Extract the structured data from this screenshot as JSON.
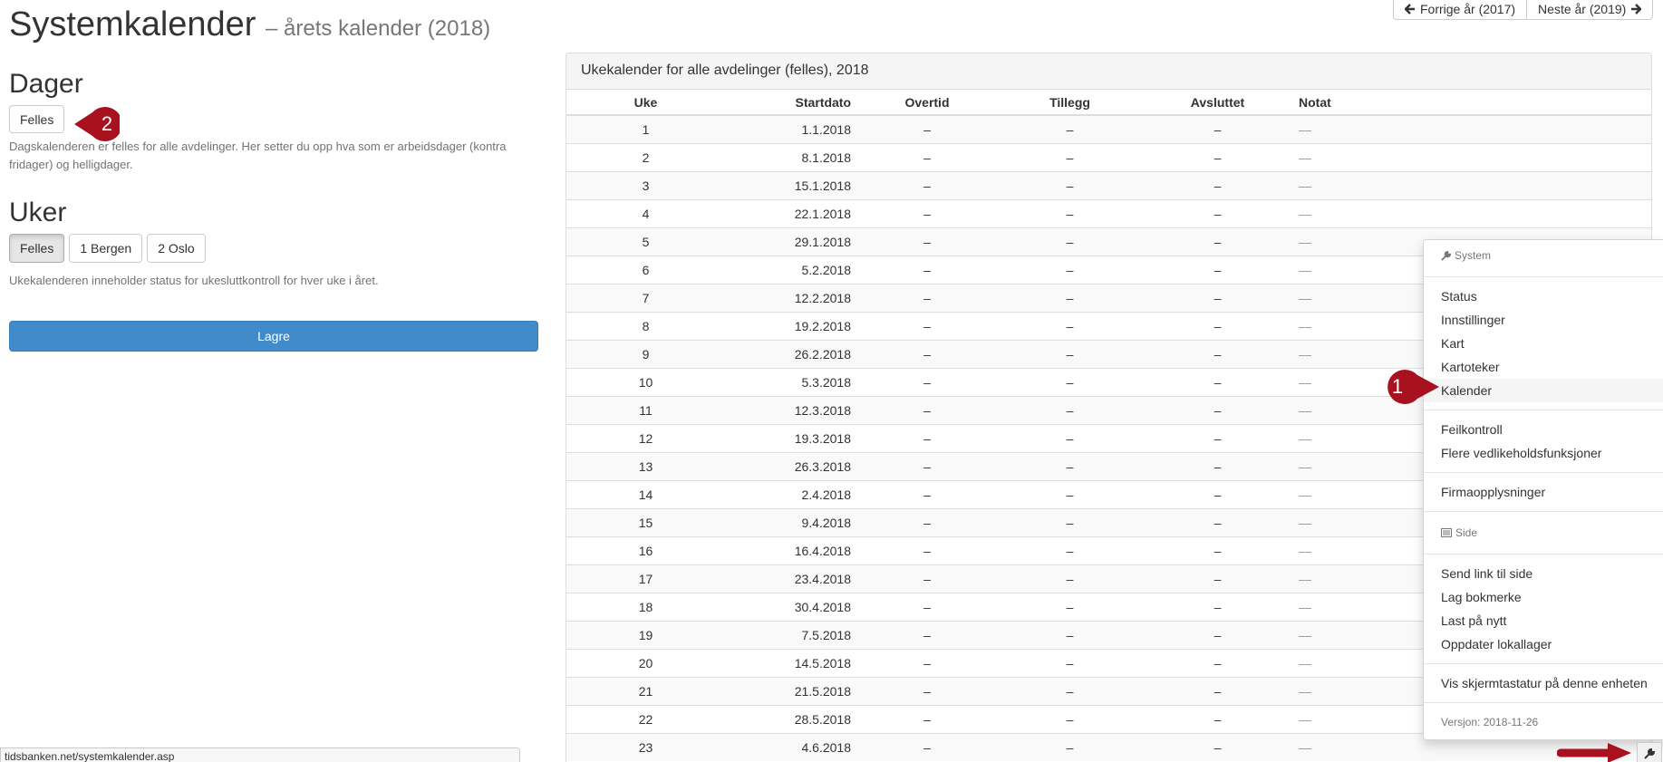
{
  "header": {
    "title": "Systemkalender",
    "subtitle": "– årets kalender (2018)",
    "prev_year": "Forrige år (2017)",
    "next_year": "Neste år (2019)"
  },
  "days": {
    "heading": "Dager",
    "felles_button": "Felles",
    "help": "Dagskalenderen er felles for alle avdelinger. Her setter du opp hva som er arbeidsdager (kontra fridager) og helligdager."
  },
  "weeks": {
    "heading": "Uker",
    "buttons": [
      "Felles",
      "1 Bergen",
      "2 Oslo"
    ],
    "help": "Ukekalenderen inneholder status for ukesluttkontroll for hver uke i året."
  },
  "save_label": "Lagre",
  "markers": {
    "one": "1",
    "two": "2"
  },
  "panel": {
    "heading": "Ukekalender for alle avdelinger (felles), 2018",
    "columns": [
      "Uke",
      "Startdato",
      "Overtid",
      "Tillegg",
      "Avsluttet",
      "Notat"
    ],
    "rows": [
      [
        "1",
        "1.1.2018",
        "–",
        "–",
        "–",
        "—"
      ],
      [
        "2",
        "8.1.2018",
        "–",
        "–",
        "–",
        "—"
      ],
      [
        "3",
        "15.1.2018",
        "–",
        "–",
        "–",
        "—"
      ],
      [
        "4",
        "22.1.2018",
        "–",
        "–",
        "–",
        "—"
      ],
      [
        "5",
        "29.1.2018",
        "–",
        "–",
        "–",
        "—"
      ],
      [
        "6",
        "5.2.2018",
        "–",
        "–",
        "–",
        "—"
      ],
      [
        "7",
        "12.2.2018",
        "–",
        "–",
        "–",
        "—"
      ],
      [
        "8",
        "19.2.2018",
        "–",
        "–",
        "–",
        "—"
      ],
      [
        "9",
        "26.2.2018",
        "–",
        "–",
        "–",
        "—"
      ],
      [
        "10",
        "5.3.2018",
        "–",
        "–",
        "–",
        "—"
      ],
      [
        "11",
        "12.3.2018",
        "–",
        "–",
        "–",
        "—"
      ],
      [
        "12",
        "19.3.2018",
        "–",
        "–",
        "–",
        "—"
      ],
      [
        "13",
        "26.3.2018",
        "–",
        "–",
        "–",
        "—"
      ],
      [
        "14",
        "2.4.2018",
        "–",
        "–",
        "–",
        "—"
      ],
      [
        "15",
        "9.4.2018",
        "–",
        "–",
        "–",
        "—"
      ],
      [
        "16",
        "16.4.2018",
        "–",
        "–",
        "–",
        "—"
      ],
      [
        "17",
        "23.4.2018",
        "–",
        "–",
        "–",
        "—"
      ],
      [
        "18",
        "30.4.2018",
        "–",
        "–",
        "–",
        "—"
      ],
      [
        "19",
        "7.5.2018",
        "–",
        "–",
        "–",
        "—"
      ],
      [
        "20",
        "14.5.2018",
        "–",
        "–",
        "–",
        "—"
      ],
      [
        "21",
        "21.5.2018",
        "–",
        "–",
        "–",
        "—"
      ],
      [
        "22",
        "28.5.2018",
        "–",
        "–",
        "–",
        "—"
      ],
      [
        "23",
        "4.6.2018",
        "–",
        "–",
        "–",
        "—"
      ]
    ]
  },
  "menu": {
    "system_header": "System",
    "system_items": [
      "Status",
      "Innstillinger",
      "Kart",
      "Kartoteker",
      "Kalender"
    ],
    "maintenance_items": [
      "Feilkontroll",
      "Flere vedlikeholdsfunksjoner"
    ],
    "company_item": "Firmaopplysninger",
    "side_header": "Side",
    "side_items": [
      "Send link til side",
      "Lag bokmerke",
      "Last på nytt",
      "Oppdater lokallager"
    ],
    "keyboard_item": "Vis skjermtastatur på denne enheten",
    "version": "Versjon: 2018-11-26"
  },
  "statusbar_url": "tidsbanken.net/systemkalender.asp",
  "colors": {
    "primary": "#428bca",
    "marker": "#a8111e"
  }
}
